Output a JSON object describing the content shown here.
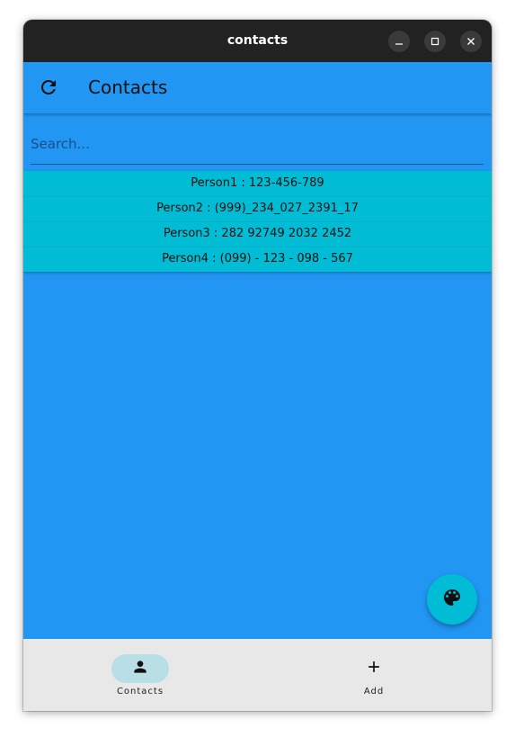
{
  "window": {
    "title": "contacts",
    "controls": {
      "minimize_icon": "minimize-icon",
      "maximize_icon": "maximize-icon",
      "close_icon": "close-icon"
    }
  },
  "appbar": {
    "title": "Contacts",
    "refresh_icon": "refresh-icon"
  },
  "search": {
    "placeholder": "Search...",
    "value": ""
  },
  "contacts": [
    "Person1 : 123-456-789",
    "Person2 : (999)_234_027_2391_17",
    "Person3 : 282 92749 2032 2452",
    "Person4 : (099) - 123 - 098 - 567"
  ],
  "fab": {
    "icon": "palette-icon"
  },
  "bottom_nav": {
    "items": [
      {
        "label": "Contacts",
        "icon": "person-icon",
        "active": true
      },
      {
        "label": "Add",
        "icon": "add-icon",
        "active": false
      }
    ]
  },
  "colors": {
    "background": "#2196f3",
    "list_background": "#00bcd4",
    "titlebar": "#222222",
    "bottom_nav": "#e8e8e8",
    "nav_active_pill": "#b8dfe6"
  }
}
